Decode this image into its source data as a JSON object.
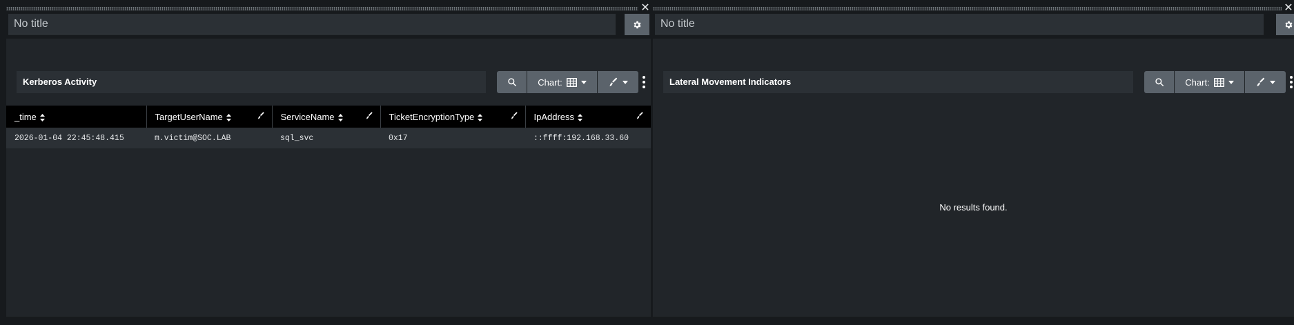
{
  "panels": [
    {
      "title_value": "No title",
      "viz_title": "Kerberos Activity",
      "toolbar": {
        "chart_label": "Chart:"
      },
      "table": {
        "columns": [
          "_time",
          "TargetUserName",
          "ServiceName",
          "TicketEncryptionType",
          "IpAddress"
        ],
        "rows": [
          [
            "2026-01-04 22:45:48.415",
            "m.victim@SOC.LAB",
            "sql_svc",
            "0x17",
            "::ffff:192.168.33.60"
          ]
        ]
      }
    },
    {
      "title_value": "No title",
      "viz_title": "Lateral Movement Indicators",
      "toolbar": {
        "chart_label": "Chart:"
      },
      "empty_message": "No results found."
    }
  ],
  "icons": {
    "close": "close-icon",
    "settings": "gear-icon",
    "search": "search-icon",
    "chart": "table-icon",
    "format": "paintbrush-icon",
    "more": "more-vertical-icon",
    "sort": "sort-icon",
    "edit": "pencil-icon"
  },
  "colors": {
    "page_bg": "#171a1d",
    "panel_bg": "#212529",
    "field_bg": "#2b3035",
    "button_bg": "#5b636b",
    "header_bg": "#000000",
    "text": "#e6e8ea"
  }
}
